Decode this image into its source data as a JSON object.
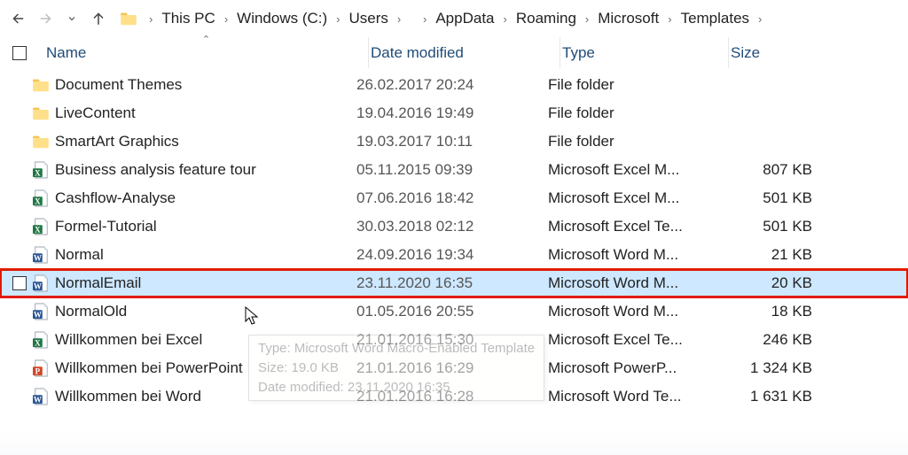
{
  "breadcrumb": {
    "segments": [
      "This PC",
      "Windows (C:)",
      "Users",
      "",
      "AppData",
      "Roaming",
      "Microsoft",
      "Templates"
    ],
    "blurred_index": 3
  },
  "columns": {
    "name": "Name",
    "date": "Date modified",
    "type": "Type",
    "size": "Size",
    "sort_on": "name"
  },
  "rows": [
    {
      "icon": "folder",
      "name": "Document Themes",
      "date": "26.02.2017 20:24",
      "type": "File folder",
      "size": ""
    },
    {
      "icon": "folder",
      "name": "LiveContent",
      "date": "19.04.2016 19:49",
      "type": "File folder",
      "size": ""
    },
    {
      "icon": "folder",
      "name": "SmartArt Graphics",
      "date": "19.03.2017 10:11",
      "type": "File folder",
      "size": ""
    },
    {
      "icon": "excel",
      "name": "Business analysis feature tour",
      "date": "05.11.2015 09:39",
      "type": "Microsoft Excel M...",
      "size": "807 KB"
    },
    {
      "icon": "excel",
      "name": "Cashflow-Analyse",
      "date": "07.06.2016 18:42",
      "type": "Microsoft Excel M...",
      "size": "501 KB"
    },
    {
      "icon": "excel",
      "name": "Formel-Tutorial",
      "date": "30.03.2018 02:12",
      "type": "Microsoft Excel Te...",
      "size": "501 KB"
    },
    {
      "icon": "word",
      "name": "Normal",
      "date": "24.09.2016 19:34",
      "type": "Microsoft Word M...",
      "size": "21 KB"
    },
    {
      "icon": "word",
      "name": "NormalEmail",
      "date": "23.11.2020 16:35",
      "type": "Microsoft Word M...",
      "size": "20 KB",
      "selected": true,
      "highlighted": true
    },
    {
      "icon": "word",
      "name": "NormalOld",
      "date": "01.05.2016 20:55",
      "type": "Microsoft Word M...",
      "size": "18 KB"
    },
    {
      "icon": "excel",
      "name": "Willkommen bei Excel",
      "date": "21.01.2016 15:30",
      "type": "Microsoft Excel Te...",
      "size": "246 KB"
    },
    {
      "icon": "ppt",
      "name": "Willkommen bei PowerPoint",
      "date": "21.01.2016 16:29",
      "type": "Microsoft PowerP...",
      "size": "1 324 KB"
    },
    {
      "icon": "word",
      "name": "Willkommen bei Word",
      "date": "21.01.2016 16:28",
      "type": "Microsoft Word Te...",
      "size": "1 631 KB"
    }
  ],
  "tooltip": {
    "line1": "Type: Microsoft Word Macro-Enabled Template",
    "line2": "Size: 19.0 KB",
    "line3": "Date modified: 23.11.2020 16:35"
  }
}
